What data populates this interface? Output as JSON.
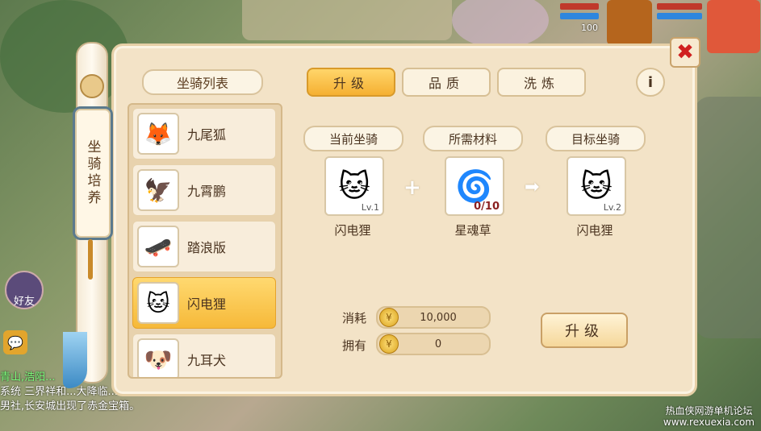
{
  "side_title": "坐骑培养",
  "list_header": "坐骑列表",
  "mounts": [
    {
      "name": "九尾狐",
      "icon": "🦊"
    },
    {
      "name": "九霄鹏",
      "icon": "🦅"
    },
    {
      "name": "踏浪版",
      "icon": "🛹"
    },
    {
      "name": "闪电狸",
      "icon": "🐱",
      "selected": true
    },
    {
      "name": "九耳犬",
      "icon": "🐶"
    }
  ],
  "tabs": [
    "升级",
    "品质",
    "洗炼"
  ],
  "info_label": "i",
  "close_label": "✖",
  "sections": {
    "current_label": "当前坐骑",
    "material_label": "所需材料",
    "target_label": "目标坐骑"
  },
  "current": {
    "name": "闪电狸",
    "level": "Lv.1",
    "icon": "🐱"
  },
  "material": {
    "name": "星魂草",
    "count": "0/10",
    "icon": "🌀"
  },
  "target": {
    "name": "闪电狸",
    "level": "Lv.2",
    "icon": "🐱"
  },
  "plus_sign": "+",
  "arrow_sign": "➡",
  "cost": {
    "label": "消耗",
    "value": "10,000"
  },
  "owned": {
    "label": "拥有",
    "value": "0"
  },
  "upgrade_button": "升级",
  "hud": {
    "hp_value": "100",
    "friend_label": "好友"
  },
  "chat_lines": [
    "青山,浩阳...",
    "系统 三界祥和...大降临...",
    "男社,长安城出现了赤金宝箱。"
  ],
  "watermark": {
    "line1": "热血侠网游单机论坛",
    "line2": "www.rexuexia.com"
  },
  "colors": {
    "accent": "#f5b032",
    "panel": "#f3e3c7",
    "close": "#d01f1f"
  }
}
